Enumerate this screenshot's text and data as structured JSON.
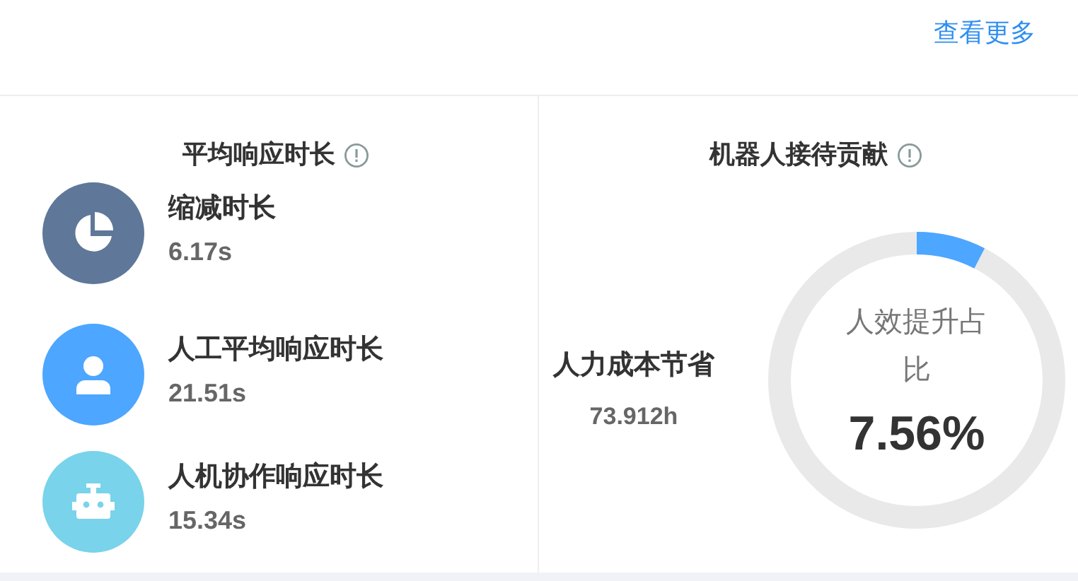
{
  "header": {
    "link": "查看更多"
  },
  "response_time": {
    "title": "平均响应时长",
    "metrics": [
      {
        "kind": "pie",
        "color": "#5f7799",
        "label": "缩减时长",
        "value": "6.17s"
      },
      {
        "kind": "person",
        "color": "#4da6ff",
        "label": "人工平均响应时长",
        "value": "21.51s"
      },
      {
        "kind": "robot",
        "color": "#79d3ea",
        "label": "人机协作响应时长",
        "value": "15.34s"
      }
    ]
  },
  "robot_contribution": {
    "title": "机器人接待贡献",
    "saving": {
      "label": "人力成本节省",
      "value": "73.912h"
    },
    "gauge": {
      "label": "人效提升占比",
      "value": "7.56%"
    }
  }
}
